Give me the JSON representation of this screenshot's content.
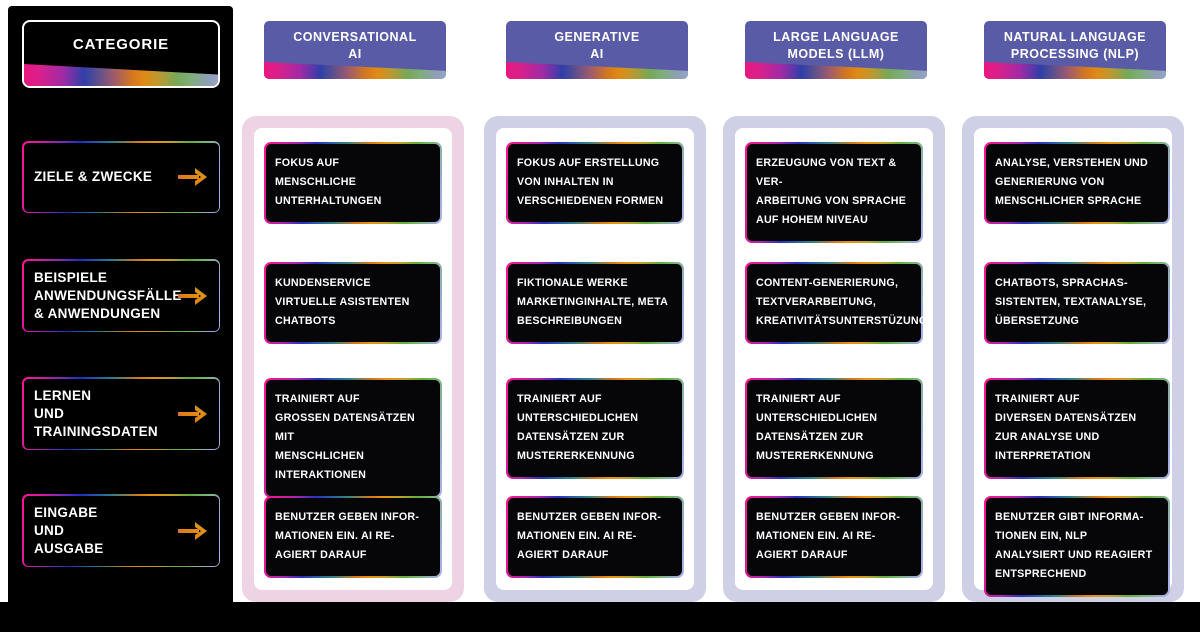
{
  "sidebar": {
    "title": "CATEGORIE",
    "items": [
      {
        "label": "ZIELE & ZWECKE",
        "icon": "arrow-right-icon"
      },
      {
        "label": "BEISPIELE\nANWENDUNGSFÄLLE\n& ANWENDUNGEN",
        "icon": "arrow-right-icon"
      },
      {
        "label": "LERNEN\nUND\nTRAININGSDATEN",
        "icon": "arrow-right-icon"
      },
      {
        "label": "EINGABE\nUND\nAUSGABE",
        "icon": "arrow-right-icon"
      }
    ]
  },
  "columns": [
    {
      "header": "CONVERSATIONAL\nAI",
      "panel_color": "#edd3e4",
      "cards": [
        "FOKUS AUF\nMENSCHLICHE\nUNTERHALTUNGEN",
        "KUNDENSERVICE\nVIRTUELLE ASISTENTEN\nCHATBOTS",
        "TRAINIERT AUF\nGROSSEN DATENSÄTZEN MIT\nMENSCHLICHEN\nINTERAKTIONEN",
        "BENUTZER GEBEN INFOR-\nMATIONEN EIN. AI RE-\nAGIERT DARAUF"
      ]
    },
    {
      "header": "GENERATIVE\nAI",
      "panel_color": "#cfd0e6",
      "cards": [
        "FOKUS AUF ERSTELLUNG\nVON INHALTEN IN\nVERSCHIEDENEN FORMEN",
        "FIKTIONALE WERKE\nMARKETINGINHALTE, META\nBESCHREIBUNGEN",
        "TRAINIERT AUF\nUNTERSCHIEDLICHEN\nDATENSÄTZEN ZUR\nMUSTERERKENNUNG",
        "BENUTZER GEBEN INFOR-\nMATIONEN EIN. AI RE-\nAGIERT DARAUF"
      ]
    },
    {
      "header": "LARGE LANGUAGE\nMODELS (LLM)",
      "panel_color": "#cfd0e6",
      "cards": [
        "ERZEUGUNG VON TEXT & VER-\nARBEITUNG VON SPRACHE\nAUF HOHEM NIVEAU",
        "CONTENT-GENERIERUNG,\nTEXTVERARBEITUNG,\nKREATIVITÄTSUNTERSTÜZUNG",
        "TRAINIERT AUF\nUNTERSCHIEDLICHEN\nDATENSÄTZEN ZUR\nMUSTERERKENNUNG",
        "BENUTZER GEBEN INFOR-\nMATIONEN EIN. AI RE-\nAGIERT DARAUF"
      ]
    },
    {
      "header": "NATURAL LANGUAGE\nPROCESSING (NLP)",
      "panel_color": "#cfd0e6",
      "cards": [
        "ANALYSE, VERSTEHEN UND\nGENERIERUNG VON\nMENSCHLICHER SPRACHE",
        "CHATBOTS, SPRACHAS-\nSISTENTEN, TEXTANALYSE,\nÜBERSETZUNG",
        "TRAINIERT AUF\nDIVERSEN DATENSÄTZEN\nZUR  ANALYSE UND\nINTERPRETATION",
        "BENUTZER GIBT INFORMA-\nTIONEN EIN, NLP\nANALYSIERT UND REAGIERT\nENTSPRECHEND"
      ]
    }
  ],
  "colors": {
    "background": "#000000",
    "header_bg": "#5a5ba6",
    "card_bg": "#060608",
    "text": "#ffffff",
    "panel_pink": "#edd3e4",
    "panel_lavender": "#cfd0e6"
  }
}
